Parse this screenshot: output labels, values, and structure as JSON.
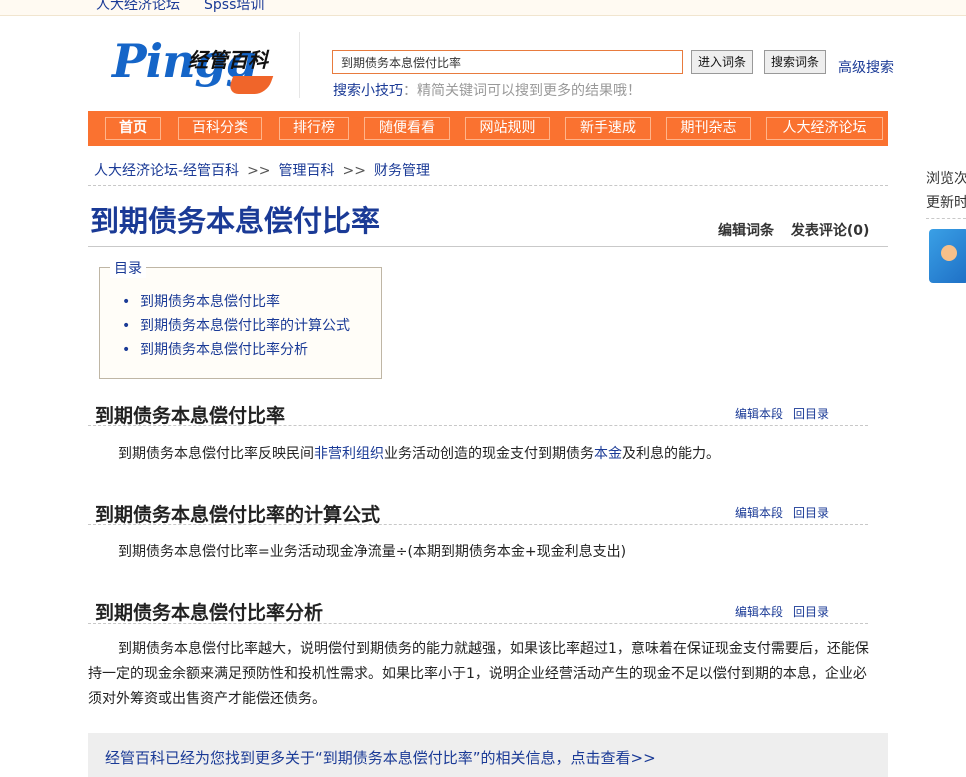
{
  "topbar": {
    "links": [
      "人大经济论坛",
      "Spss培训"
    ]
  },
  "logo": {
    "wordmark": "Pingg",
    "chinese": "经管百科"
  },
  "search": {
    "value": "到期债务本息偿付比率",
    "enter_label": "进入词条",
    "search_label": "搜索词条",
    "advanced_label": "高级搜索",
    "tips_label": "搜索小技巧",
    "tips_text": "：精简关键词可以搜到更多的结果哦！"
  },
  "nav": {
    "items": [
      "首页",
      "百科分类",
      "排行榜",
      "随便看看",
      "网站规则",
      "新手速成",
      "期刊杂志",
      "人大经济论坛"
    ]
  },
  "breadcrumb": {
    "items": [
      "人大经济论坛-经管百科",
      "管理百科",
      "财务管理"
    ],
    "separator": ">>"
  },
  "title": "到期债务本息偿付比率",
  "title_actions": {
    "edit": "编辑词条",
    "comment": "发表评论(0)"
  },
  "toc": {
    "legend": "目录",
    "items": [
      "到期债务本息偿付比率",
      "到期债务本息偿付比率的计算公式",
      "到期债务本息偿付比率分析"
    ]
  },
  "section_actions": {
    "edit": "编辑本段",
    "back": "回目录"
  },
  "sections": [
    {
      "title": "到期债务本息偿付比率",
      "p1": "到期债务本息偿付比率反映民间",
      "link1": "非营利组织",
      "p2": "业务活动创造的现金支付到期债务",
      "link2": "本金",
      "p3": "及利息的能力。"
    },
    {
      "title": "到期债务本息偿付比率的计算公式",
      "text": "到期债务本息偿付比率=业务活动现金净流量÷(本期到期债务本金+现金利息支出)"
    },
    {
      "title": "到期债务本息偿付比率分析",
      "text": "到期债务本息偿付比率越大，说明偿付到期债务的能力就越强，如果该比率超过1，意味着在保证现金支付需要后，还能保持一定的现金余额来满足预防性和投机性需求。如果比率小于1，说明企业经营活动产生的现金不足以偿付到期的本息，企业必须对外筹资或出售资产才能偿还债务。"
    }
  ],
  "more": "经管百科已经为您找到更多关于“到期债务本息偿付比率”的相关信息，点击查看>>",
  "side": {
    "line1": "浏览次",
    "line2": "更新时"
  },
  "colors": {
    "accent": "#fa7230",
    "link": "#1a3a96"
  }
}
